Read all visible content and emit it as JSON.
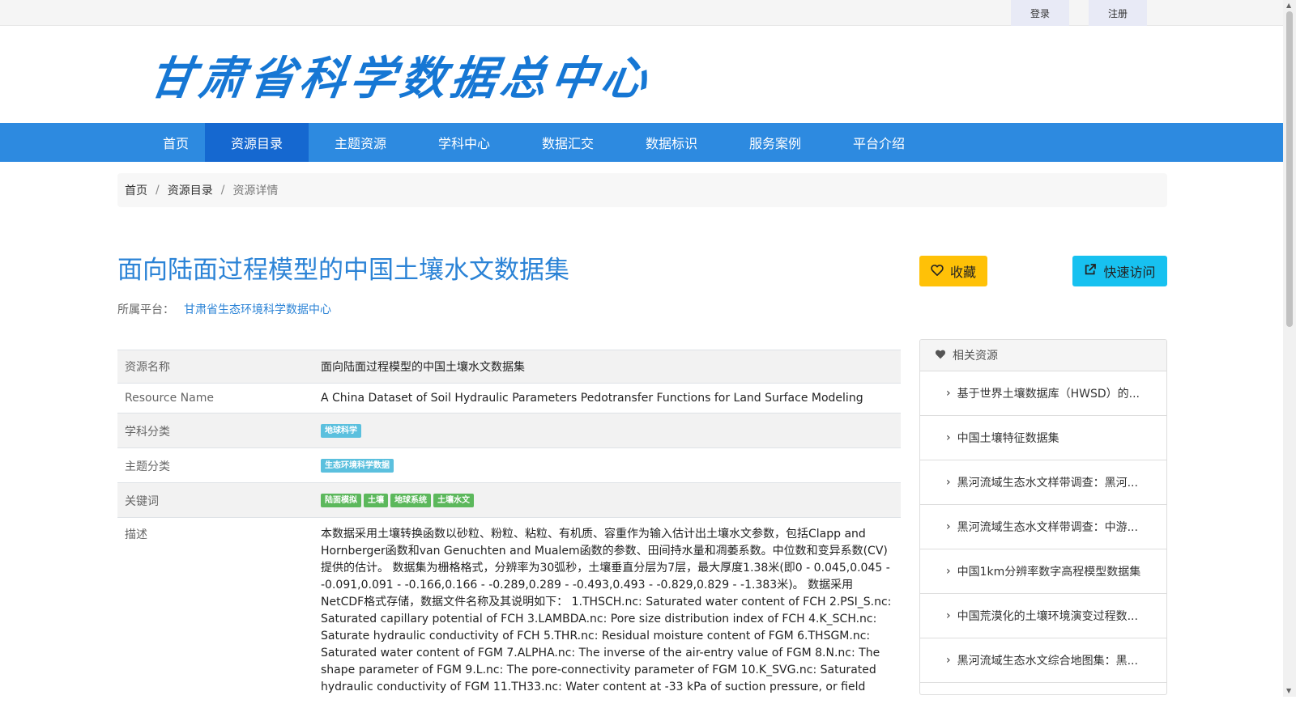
{
  "top_bar": {
    "login_label": "登录",
    "register_label": "注册"
  },
  "header": {
    "logo_text": "甘肃省科学数据总中心"
  },
  "nav": {
    "items": [
      "首页",
      "资源目录",
      "主题资源",
      "学科中心",
      "数据汇交",
      "数据标识",
      "服务案例",
      "平台介绍"
    ],
    "active": "资源目录"
  },
  "breadcrumb": {
    "home": "首页",
    "catalog": "资源目录",
    "current": "资源详情",
    "separator": "/"
  },
  "dataset": {
    "title": "面向陆面过程模型的中国土壤水文数据集",
    "platform_label": "所属平台：",
    "platform_name": "甘肃省生态环境科学数据中心"
  },
  "actions": {
    "favorite_label": "收藏",
    "visit_label": "快速访问"
  },
  "info": {
    "rows": [
      {
        "key": "资源名称",
        "value": "面向陆面过程模型的中国土壤水文数据集"
      },
      {
        "key": "Resource Name",
        "value": "A China Dataset of Soil Hydraulic Parameters Pedotransfer Functions for Land Surface Modeling"
      },
      {
        "key": "学科分类",
        "tags": [
          "地球科学"
        ]
      },
      {
        "key": "主题分类",
        "tags": [
          "生态环境科学数据"
        ]
      },
      {
        "key": "关键词",
        "tags": [
          "陆面模拟",
          "土壤",
          "地球系统",
          "土壤水文"
        ]
      },
      {
        "key": "描述",
        "value": "本数据采用土壤转换函数以砂粒、粉粒、粘粒、有机质、容重作为输入估计出土壤水文参数，包括Clapp and Hornberger函数和van Genuchten and Mualem函数的参数、田间持水量和凋萎系数。中位数和变异系数(CV)提供的估计。 数据集为栅格格式，分辨率为30弧秒，土壤垂直分层为7层，最大厚度1.38米(即0 - 0.045,0.045 - -0.091,0.091 - -0.166,0.166 - -0.289,0.289 - -0.493,0.493 - -0.829,0.829 - -1.383米)。 数据采用NetCDF格式存储，数据文件名称及其说明如下： 1.THSCH.nc: Saturated water content of FCH 2.PSI_S.nc: Saturated capillary potential of FCH 3.LAMBDA.nc: Pore size distribution index of FCH 4.K_SCH.nc: Saturate hydraulic conductivity of FCH 5.THR.nc: Residual moisture content of FGM 6.THSGM.nc: Saturated water content of FGM 7.ALPHA.nc: The inverse of the air-entry value of FGM 8.N.nc: The shape parameter of FGM 9.L.nc: The pore-connectivity parameter of FGM 10.K_SVG.nc: Saturated hydraulic conductivity of FGM 11.TH33.nc: Water content at -33 kPa of suction pressure, or field"
      }
    ]
  },
  "related": {
    "heading": "相关资源",
    "items": [
      "基于世界土壤数据库（HWSD）的...",
      "中国土壤特征数据集",
      "黑河流域生态水文样带调查：黑河...",
      "黑河流域生态水文样带调查：中游...",
      "中国1km分辨率数字高程模型数据集",
      "中国荒漠化的土壤环境演变过程数...",
      "黑河流域生态水文综合地图集：黑..."
    ]
  },
  "colors": {
    "nav_bg": "#2d8ae0",
    "nav_active": "#1568d0",
    "title": "#2b83d6",
    "favorite_btn": "#ffc107",
    "visit_btn": "#17c1f0",
    "tag_blue": "#5bc0de",
    "tag_green": "#5cb85c"
  },
  "icons": {
    "favorite": "heart-icon",
    "visit": "external-link-icon",
    "related": "heart-icon",
    "related_item": "chevron-right-icon"
  }
}
